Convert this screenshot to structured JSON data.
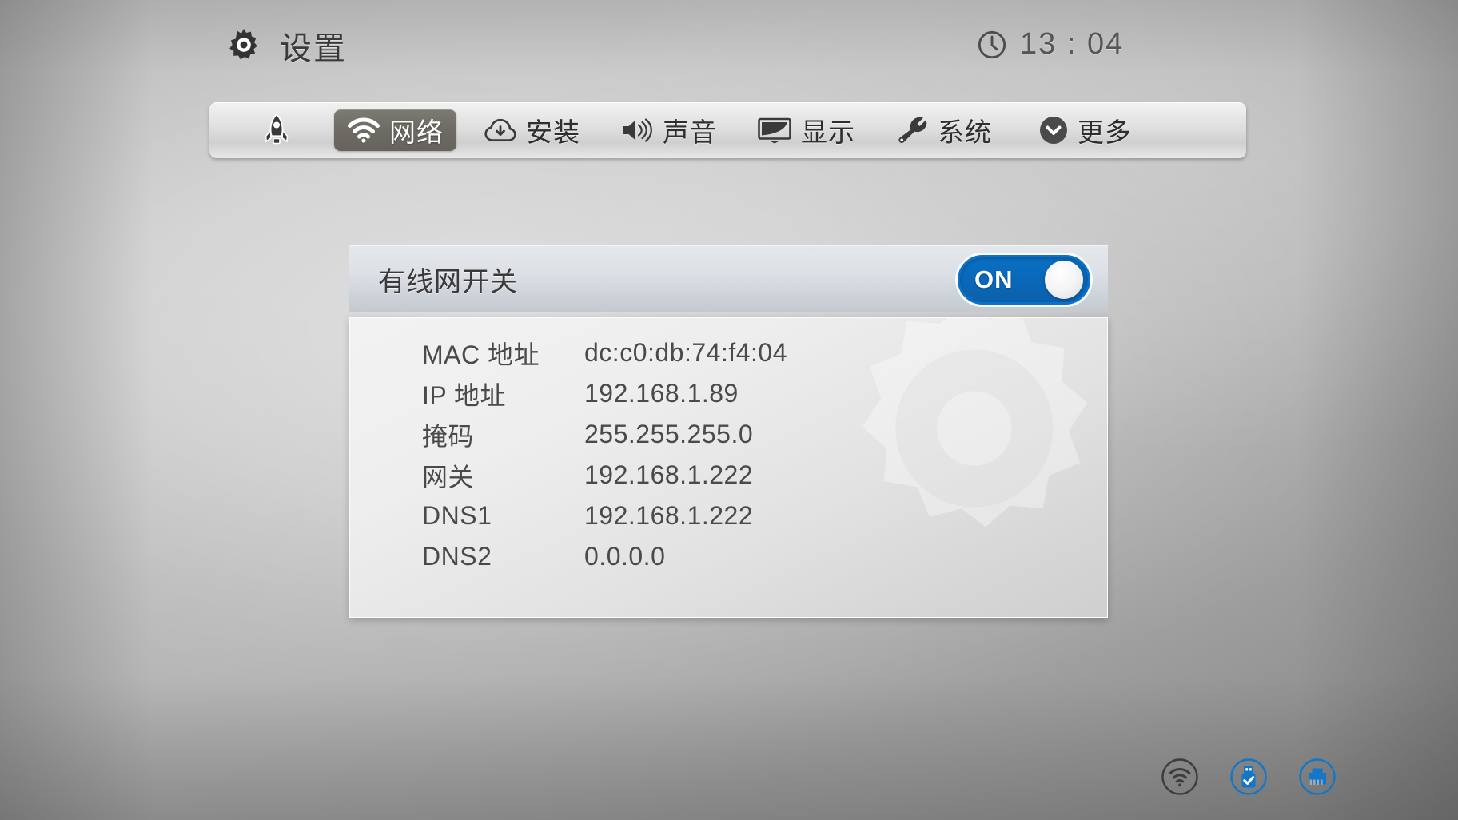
{
  "header": {
    "title": "设置",
    "gear_icon": "gear-icon",
    "clock_icon": "clock-icon",
    "clock_time": "13 : 04"
  },
  "tabs": [
    {
      "id": "home",
      "label": "",
      "icon": "rocket-icon",
      "active": false
    },
    {
      "id": "network",
      "label": "网络",
      "icon": "wifi-icon",
      "active": true
    },
    {
      "id": "install",
      "label": "安装",
      "icon": "cloud-download-icon",
      "active": false
    },
    {
      "id": "sound",
      "label": "声音",
      "icon": "speaker-icon",
      "active": false
    },
    {
      "id": "display",
      "label": "显示",
      "icon": "monitor-icon",
      "active": false
    },
    {
      "id": "system",
      "label": "系统",
      "icon": "wrench-icon",
      "active": false
    },
    {
      "id": "more",
      "label": "更多",
      "icon": "chevron-down-circle-icon",
      "active": false
    }
  ],
  "card": {
    "header_label": "有线网开关",
    "toggle": {
      "state_label": "ON",
      "on": true,
      "accent_color": "#0a6ac0"
    },
    "rows": [
      {
        "key": "MAC 地址",
        "value": "dc:c0:db:74:f4:04"
      },
      {
        "key": "IP 地址",
        "value": "192.168.1.89"
      },
      {
        "key": "掩码",
        "value": "255.255.255.0"
      },
      {
        "key": "网关",
        "value": "192.168.1.222"
      },
      {
        "key": "DNS1",
        "value": "192.168.1.222"
      },
      {
        "key": "DNS2",
        "value": "0.0.0.0"
      }
    ]
  },
  "status_icons": [
    {
      "id": "wifi",
      "icon": "wifi-status-icon",
      "active": false,
      "color": "#3c3c3c"
    },
    {
      "id": "usb",
      "icon": "usb-check-status-icon",
      "active": true,
      "color": "#1277c8"
    },
    {
      "id": "ethernet",
      "icon": "ethernet-status-icon",
      "active": true,
      "color": "#1277c8"
    }
  ]
}
